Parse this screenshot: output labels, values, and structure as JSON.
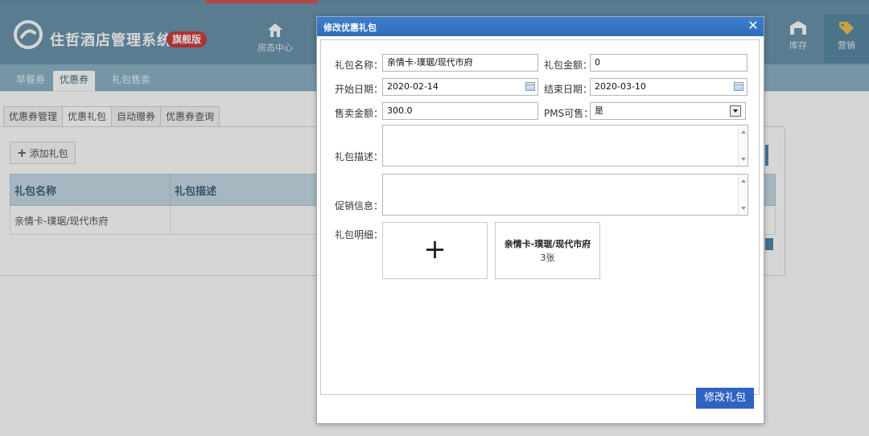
{
  "app": {
    "brand": "住哲酒店管理系统",
    "edition_badge": "旗舰版",
    "nav": {
      "room_center": "房态中心",
      "inventory": "库存",
      "marketing": "营销"
    }
  },
  "subnav": [
    "早餐券",
    "优惠券",
    "礼包售卖"
  ],
  "content_tabs": [
    "优惠券管理",
    "优惠礼包",
    "自动赠券",
    "优惠券查询"
  ],
  "toolbar": {
    "add_label": "添加礼包"
  },
  "table": {
    "headers": [
      "礼包名称",
      "礼包描述"
    ],
    "rows": [
      {
        "name": "亲情卡-璞琚/现代市府",
        "desc": ""
      }
    ]
  },
  "modal": {
    "title": "修改优惠礼包",
    "fields": {
      "name_label": "礼包名称：",
      "name_value": "亲情卡-璞琚/现代市府",
      "amount_label": "礼包金额：",
      "amount_value": "0",
      "start_label": "开始日期：",
      "start_value": "2020-02-14",
      "end_label": "结束日期：",
      "end_value": "2020-03-10",
      "price_label": "售卖金额：",
      "price_value": "300.0",
      "pms_label": "PMS可售：",
      "pms_value": "是",
      "desc_label": "礼包描述：",
      "promo_label": "促销信息：",
      "detail_label": "礼包明细："
    },
    "detail_item": {
      "name": "亲情卡-璞琚/现代市府",
      "count": "3张"
    },
    "submit_label": "修改礼包"
  },
  "colors": {
    "header_bg": "#6a94ad",
    "modal_title_bg": "#2f6db8",
    "primary_button": "#2e63c4",
    "badge_red": "#cf3c3c"
  }
}
